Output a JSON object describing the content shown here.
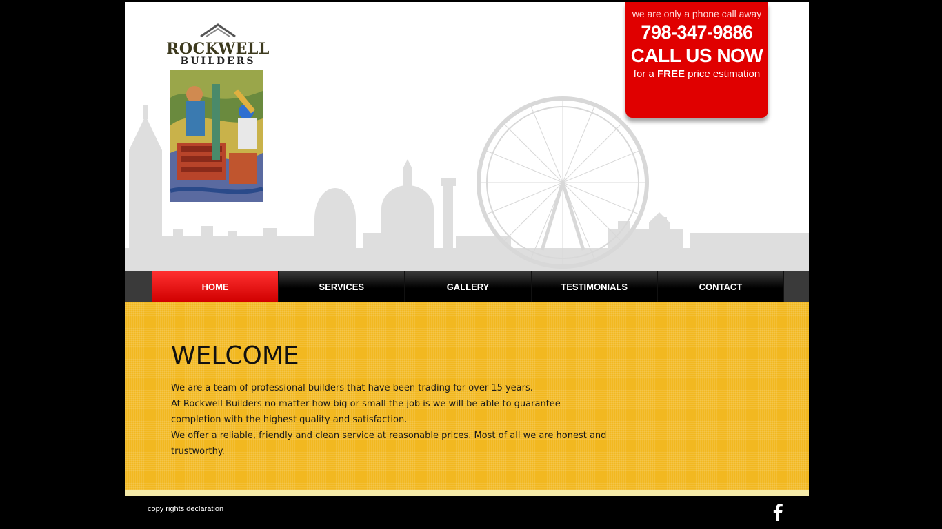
{
  "brand": {
    "name": "ROCKWELL",
    "subtitle": "BUILDERS"
  },
  "callout": {
    "tagline": "we are only a phone call away",
    "phone": "798-347-9886",
    "cta": "CALL US NOW",
    "offer_prefix": "for a ",
    "offer_bold": "FREE",
    "offer_suffix": " price estimation"
  },
  "nav": {
    "items": [
      {
        "label": "HOME",
        "active": true
      },
      {
        "label": "SERVICES"
      },
      {
        "label": "GALLERY"
      },
      {
        "label": "TESTIMONIALS"
      },
      {
        "label": "CONTACT"
      }
    ]
  },
  "welcome": {
    "title": "WELCOME",
    "paragraphs": [
      "We are a team of professional builders that have been trading for over 15 years.",
      "At Rockwell Builders no matter how big or small the job is we will be able to guarantee completion with the highest quality and satisfaction.",
      "We offer a reliable, friendly and clean service at reasonable prices. Most of all we are honest and trustworthy."
    ]
  },
  "footer": {
    "copyright": "copy rights declaration",
    "social_icon": "facebook-icon"
  },
  "colors": {
    "accent_red": "#e00000",
    "content_yellow": "#f2b820",
    "nav_dark": "#000000"
  }
}
